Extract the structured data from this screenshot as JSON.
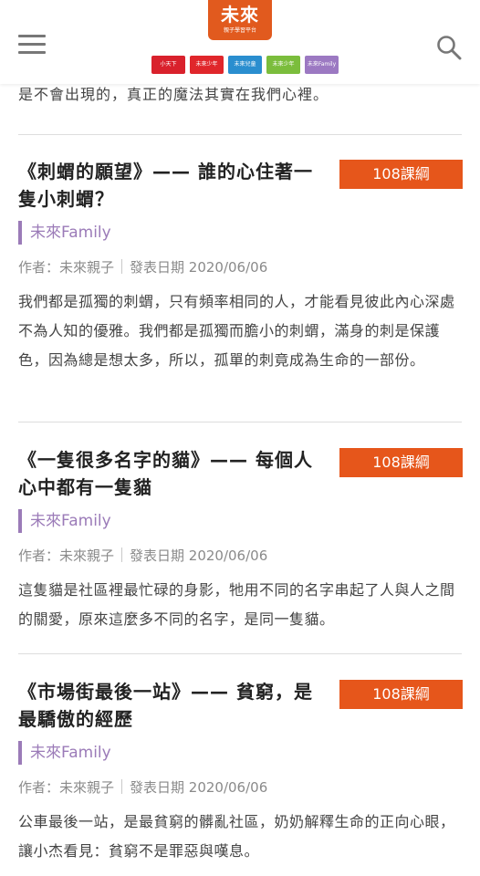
{
  "header": {
    "logo_mark": "未來",
    "logo_sub": "親子學習平台",
    "brands": [
      {
        "label": "小天下",
        "color": "#d9212c"
      },
      {
        "label": "未來少年",
        "color": "#e0262b"
      },
      {
        "label": "未來兒童",
        "color": "#2a8ecf"
      },
      {
        "label": "未來少年",
        "color": "#7bbd3c"
      },
      {
        "label": "未來Family",
        "color": "#9c79c2"
      }
    ]
  },
  "top_text": "是不會出現的，真正的魔法其實在我們心裡。",
  "articles": [
    {
      "title": "《刺蝟的願望》—— 誰的心住著一隻小刺蝟？",
      "tag": "108課綱",
      "source": "未來Family",
      "author": "作者：未來親子",
      "date": "發表日期 2020/06/06",
      "desc": "我們都是孤獨的刺蝟，只有頻率相同的人，才能看見彼此內心深處不為人知的優雅。我們都是孤獨而膽小的刺蝟，滿身的刺是保護色，因為總是想太多，所以，孤單的刺竟成為生命的一部份。"
    },
    {
      "title": "《一隻很多名字的貓》—— 每個人心中都有一隻貓",
      "tag": "108課綱",
      "source": "未來Family",
      "author": "作者：未來親子",
      "date": "發表日期 2020/06/06",
      "desc": "這隻貓是社區裡最忙碌的身影，牠用不同的名字串起了人與人之間的關愛，原來這麼多不同的名字，是同一隻貓。"
    },
    {
      "title": "《市場街最後一站》—— 貧窮，是最驕傲的經歷",
      "tag": "108課綱",
      "source": "未來Family",
      "author": "作者：未來親子",
      "date": "發表日期 2020/06/06",
      "desc": "公車最後一站，是最貧窮的髒亂社區，奶奶解釋生命的正向心眼，讓小杰看見：貧窮不是罪惡與嘆息。"
    }
  ]
}
